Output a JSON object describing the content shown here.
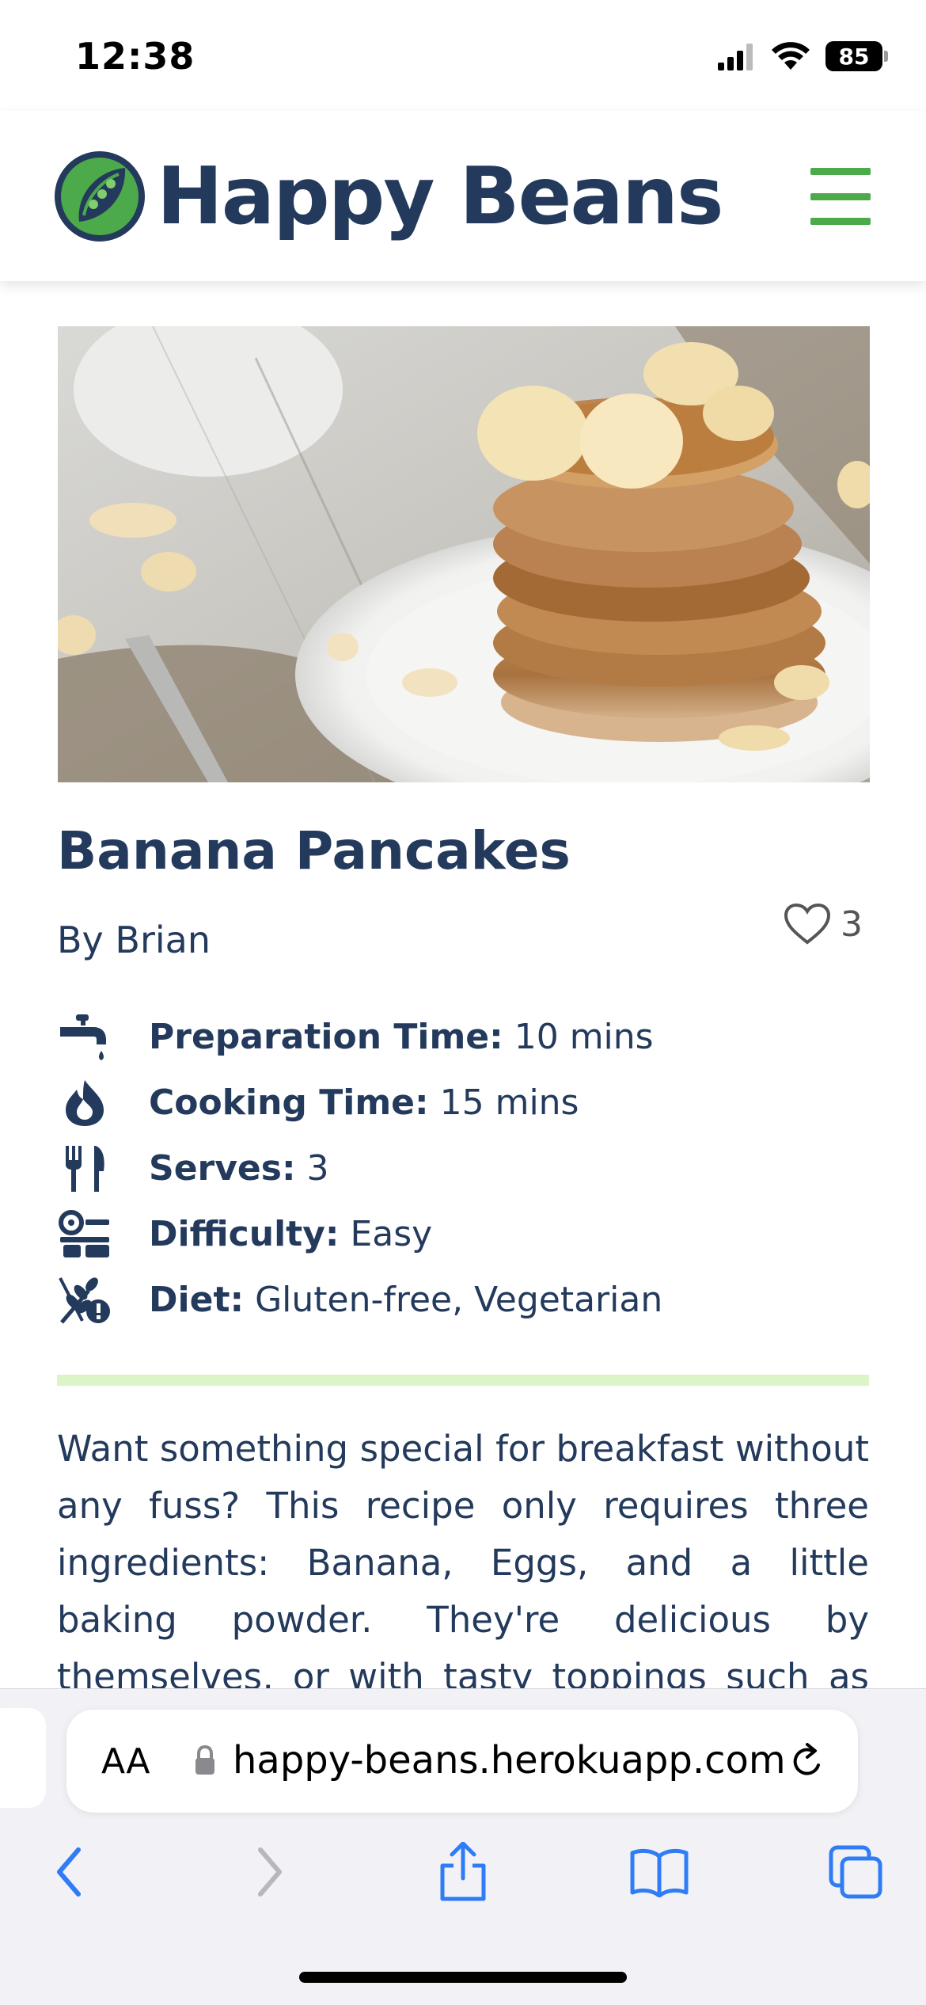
{
  "status_bar": {
    "time": "12:38",
    "battery": "85"
  },
  "header": {
    "brand": "Happy Beans",
    "menu_icon": "hamburger-menu-icon"
  },
  "recipe": {
    "title": "Banana Pancakes",
    "author": "By Brian",
    "likes": "3",
    "meta": [
      {
        "icon": "tap-icon",
        "label": "Preparation Time:",
        "value": " 10 mins"
      },
      {
        "icon": "flame-icon",
        "label": "Cooking Time:",
        "value": " 15 mins"
      },
      {
        "icon": "utensils-icon",
        "label": "Serves:",
        "value": " 3"
      },
      {
        "icon": "difficulty-icon",
        "label": "Difficulty:",
        "value": " Easy"
      },
      {
        "icon": "diet-icon",
        "label": "Diet:",
        "value": " Gluten-free, Vegetarian"
      }
    ],
    "description": "Want something special for breakfast without any fuss? This recipe only requires three ingredients: Banana, Eggs, and a little baking powder. They're delicious by themselves, or with tasty toppings such as berries, honey, or a"
  },
  "browser": {
    "text_size": "AA",
    "url": "happy-beans.herokuapp.com"
  },
  "colors": {
    "brand_navy": "#233a5c",
    "brand_green": "#4caa4a",
    "divider_green": "#dcf5c8",
    "ios_blue": "#2f7cf6"
  }
}
